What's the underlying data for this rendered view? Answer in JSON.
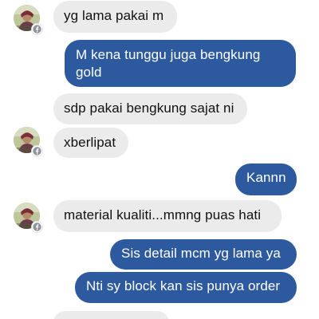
{
  "messages": [
    {
      "side": "in",
      "text": "yg lama pakai m",
      "avatar": true
    },
    {
      "side": "out",
      "text": "M kena tunggu juga bengkung gold"
    },
    {
      "side": "in",
      "text": "sdp pakai bengkung sajat ni"
    },
    {
      "side": "in",
      "text": "xberlipat",
      "avatar": true
    },
    {
      "side": "out",
      "text": "Kannn"
    },
    {
      "side": "in",
      "text": "material kualiti...mmng puas hati",
      "avatar": true
    },
    {
      "side": "out",
      "text": "Sis detail mcm yg lama ya"
    },
    {
      "side": "out",
      "text": "Nti sy block kan sis punya order"
    }
  ],
  "icons": {
    "avatar": "contact-avatar-photo",
    "badge": "facebook-badge-icon"
  },
  "colors": {
    "incoming_bubble": "#ebebeb",
    "outgoing_bubble": "#2d5a9e",
    "outgoing_text": "#ffffff",
    "incoming_text": "#111111",
    "background": "#ffffff"
  }
}
